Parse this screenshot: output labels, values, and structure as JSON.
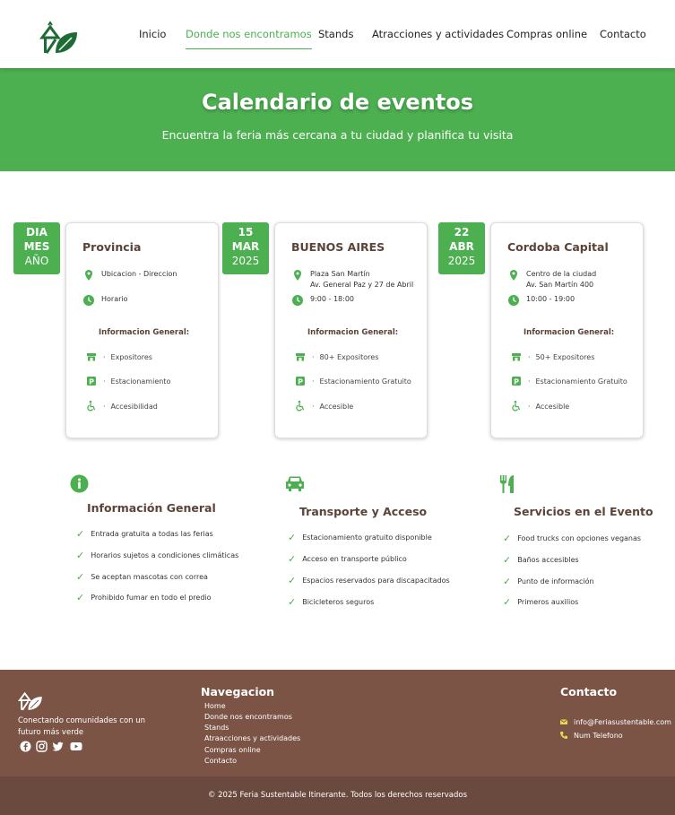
{
  "nav": [
    "Inicio",
    "Donde nos encontramos",
    "Stands",
    "Atracciones y actividades",
    "Compras online",
    "Contacto"
  ],
  "hero": {
    "title": "Calendario de eventos",
    "subtitle": "Encuentra la feria más cercana a tu ciudad y planifica tu visita"
  },
  "events": [
    {
      "date": {
        "d": "DIA",
        "m": "MES",
        "y": "AÑO"
      },
      "city": "Provincia",
      "loc1": "Ubicacion - Direccion",
      "loc2": "",
      "time": "Horario",
      "general": "Informacion General:",
      "f1": "Expositores",
      "f2": "Estacionamiento",
      "f3": "Accesibilidad"
    },
    {
      "date": {
        "d": "15",
        "m": "MAR",
        "y": "2025"
      },
      "city": "BUENOS AIRES",
      "loc1": "Plaza San Martín",
      "loc2": "Av. General Paz y 27 de Abril",
      "time": "9:00 - 18:00",
      "general": "Informacion General:",
      "f1": "80+ Expositores",
      "f2": "Estacionamiento Gratuito",
      "f3": "Accesible"
    },
    {
      "date": {
        "d": "22",
        "m": "ABR",
        "y": "2025"
      },
      "city": "Cordoba Capital",
      "loc1": "Centro de la ciudad",
      "loc2": "Av. San Martín 400",
      "time": "10:00 - 19:00",
      "general": "Informacion General:",
      "f1": "50+ Expositores",
      "f2": "Estacionamiento Gratuito",
      "f3": "Accesible"
    }
  ],
  "info": [
    {
      "title": "Información General",
      "items": [
        "Entrada gratuita a todas las ferias",
        "Horarios sujetos a condiciones climáticas",
        "Se aceptan mascotas con correa",
        "Prohibido fumar en todo el predio"
      ]
    },
    {
      "title": "Transporte y Acceso",
      "items": [
        "Estacionamiento gratuito disponible",
        "Acceso en transporte público",
        "Espacios reservados para discapacitados",
        "Bicicleteros seguros"
      ]
    },
    {
      "title": "Servicios en el Evento",
      "items": [
        "Food trucks con opciones veganas",
        "Baños accesibles",
        "Punto de información",
        "Primeros auxilios"
      ]
    }
  ],
  "footer": {
    "tagline": "Conectando comunidades con un futuro más verde",
    "nav_title": "Navegacion",
    "links": [
      "Home",
      "Donde nos encontramos",
      "Stands",
      "Atraacciones y actividades",
      "Compras online",
      "Contacto"
    ],
    "contact_title": "Contacto",
    "email": "info@Feriasustentable.com",
    "phone": "Num Telefono",
    "copyright": "© 2025 Feria Sustentable Itinerante. Todos los derechos reservados"
  },
  "colors": {
    "green": "#4caf50",
    "brown": "#7b5446",
    "dark_brown": "#6a4a3f",
    "heading": "#5b4338"
  }
}
